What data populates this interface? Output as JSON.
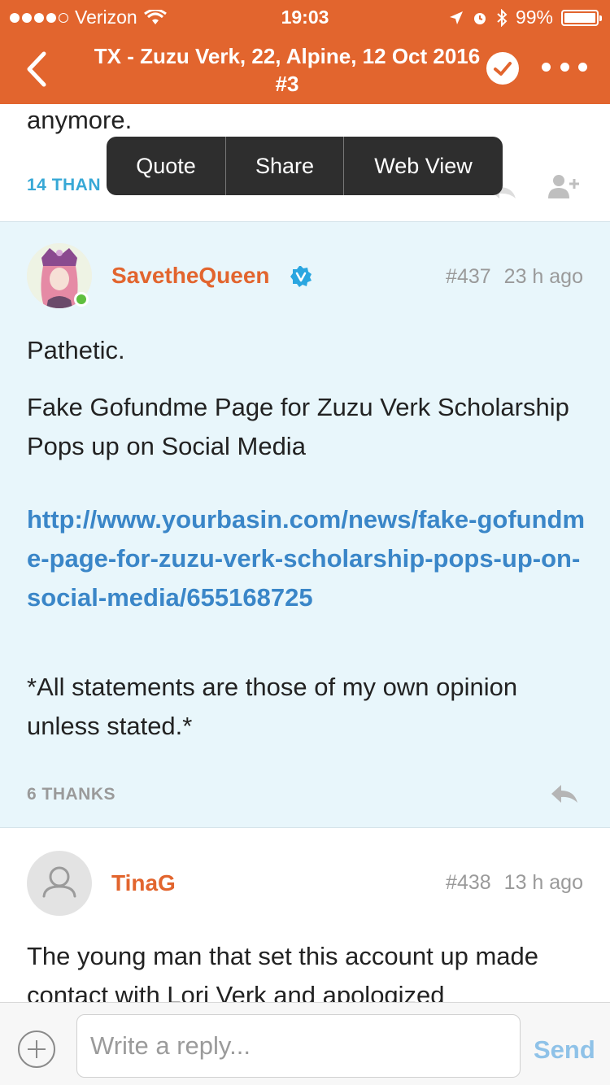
{
  "status_bar": {
    "carrier": "Verizon",
    "time": "19:03",
    "battery": "99%"
  },
  "nav": {
    "title": "TX - Zuzu Verk, 22, Alpine, 12 Oct 2016 #3"
  },
  "previous_post": {
    "text_tail": "anymore.",
    "thanks": "14 THAN"
  },
  "context_menu": {
    "items": [
      "Quote",
      "Share",
      "Web View"
    ]
  },
  "posts": [
    {
      "username": "SavetheQueen",
      "number": "#437",
      "time_ago": "23 h ago",
      "paragraphs": [
        "Pathetic.",
        "Fake Gofundme Page for Zuzu Verk Scholarship Pops up on Social Media"
      ],
      "link": "http://www.yourbasin.com/news/fake-gofundme-page-for-zuzu-verk-scholarship-pops-up-on-social-media/655168725",
      "signature": "*All statements are those of my own opinion unless stated.*",
      "thanks": "6 THANKS"
    },
    {
      "username": "TinaG",
      "number": "#438",
      "time_ago": "13 h ago",
      "text": "The young man that set this account up made contact with Lori Verk and apologized"
    }
  ],
  "reply_bar": {
    "placeholder": "Write a reply...",
    "send_label": "Send"
  },
  "colors": {
    "brand": "#E2652E",
    "link": "#3A86C8",
    "highlight_bg": "#E8F6FB",
    "thanks_blue": "#37A8D6"
  }
}
